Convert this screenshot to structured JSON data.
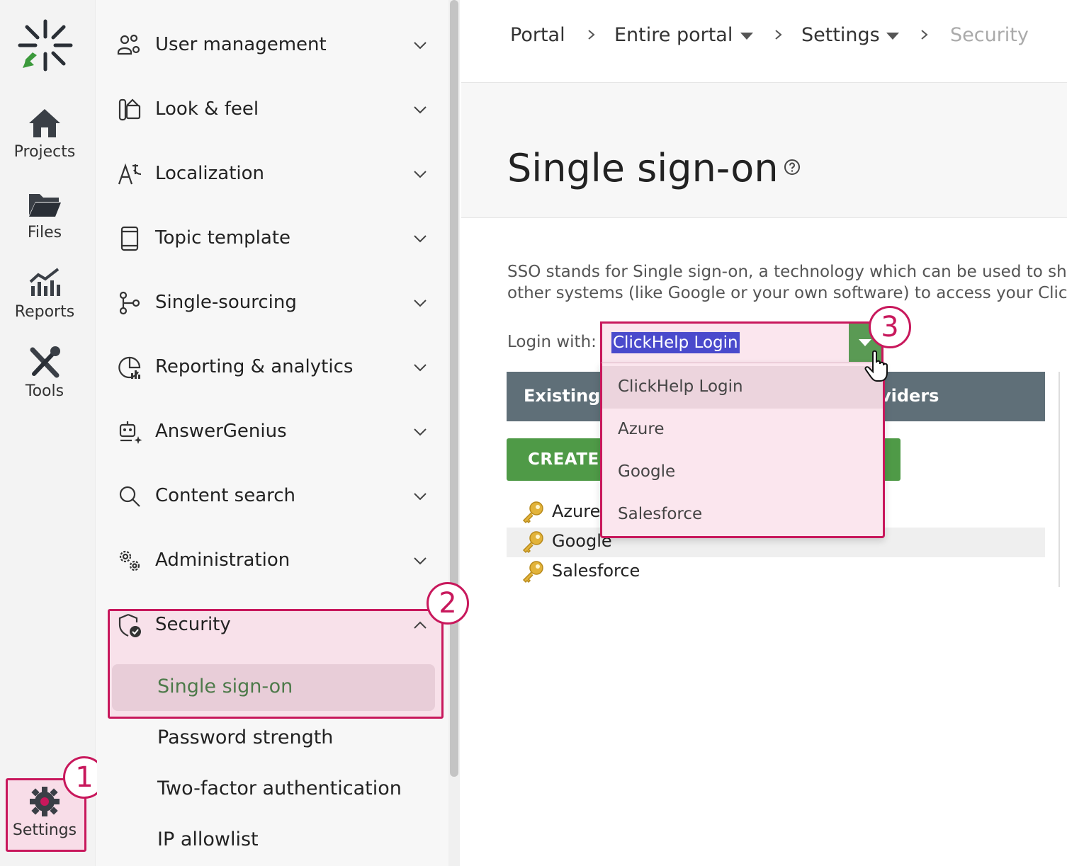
{
  "rail": {
    "items": [
      {
        "label": "Projects",
        "icon": "home-icon"
      },
      {
        "label": "Files",
        "icon": "folder-icon"
      },
      {
        "label": "Reports",
        "icon": "chart-icon"
      },
      {
        "label": "Tools",
        "icon": "tools-icon"
      }
    ],
    "settings": {
      "label": "Settings",
      "icon": "gear-icon"
    }
  },
  "callouts": {
    "one": "1",
    "two": "2",
    "three": "3"
  },
  "sidebar": {
    "items": [
      {
        "label": "User management",
        "icon": "users-gear-icon"
      },
      {
        "label": "Look & feel",
        "icon": "palette-icon"
      },
      {
        "label": "Localization",
        "icon": "translate-icon"
      },
      {
        "label": "Topic template",
        "icon": "page-icon"
      },
      {
        "label": "Single-sourcing",
        "icon": "branch-icon"
      },
      {
        "label": "Reporting & analytics",
        "icon": "analytics-icon"
      },
      {
        "label": "AnswerGenius",
        "icon": "robot-icon"
      },
      {
        "label": "Content search",
        "icon": "search-icon"
      },
      {
        "label": "Administration",
        "icon": "gears-icon"
      }
    ],
    "security": {
      "label": "Security",
      "icon": "shield-check-icon",
      "subitems": [
        "Single sign-on",
        "Password strength",
        "Two-factor authentication",
        "IP allowlist"
      ]
    }
  },
  "breadcrumb": {
    "portal": "Portal",
    "entire_portal": "Entire portal",
    "settings": "Settings",
    "security": "Security"
  },
  "main": {
    "title": "Single sign-on",
    "description_line1": "SSO stands for Single sign-on, a technology which can be used to sha",
    "description_line2": "other systems (like Google or your own software) to access your ClickH",
    "login_label": "Login with:",
    "login_value": "ClickHelp Login",
    "table_header_left": "Existing C",
    "table_header_right": "viders",
    "create_button": "CREATE",
    "providers": [
      "Azure",
      "Google",
      "Salesforce"
    ]
  },
  "dropdown": {
    "options": [
      "ClickHelp Login",
      "Azure",
      "Google",
      "Salesforce"
    ],
    "selected": "ClickHelp Login"
  },
  "colors": {
    "accent": "#c8185c",
    "green": "#4f9a47",
    "header_gray": "#5f6f78",
    "highlight": "#4a4acc"
  }
}
